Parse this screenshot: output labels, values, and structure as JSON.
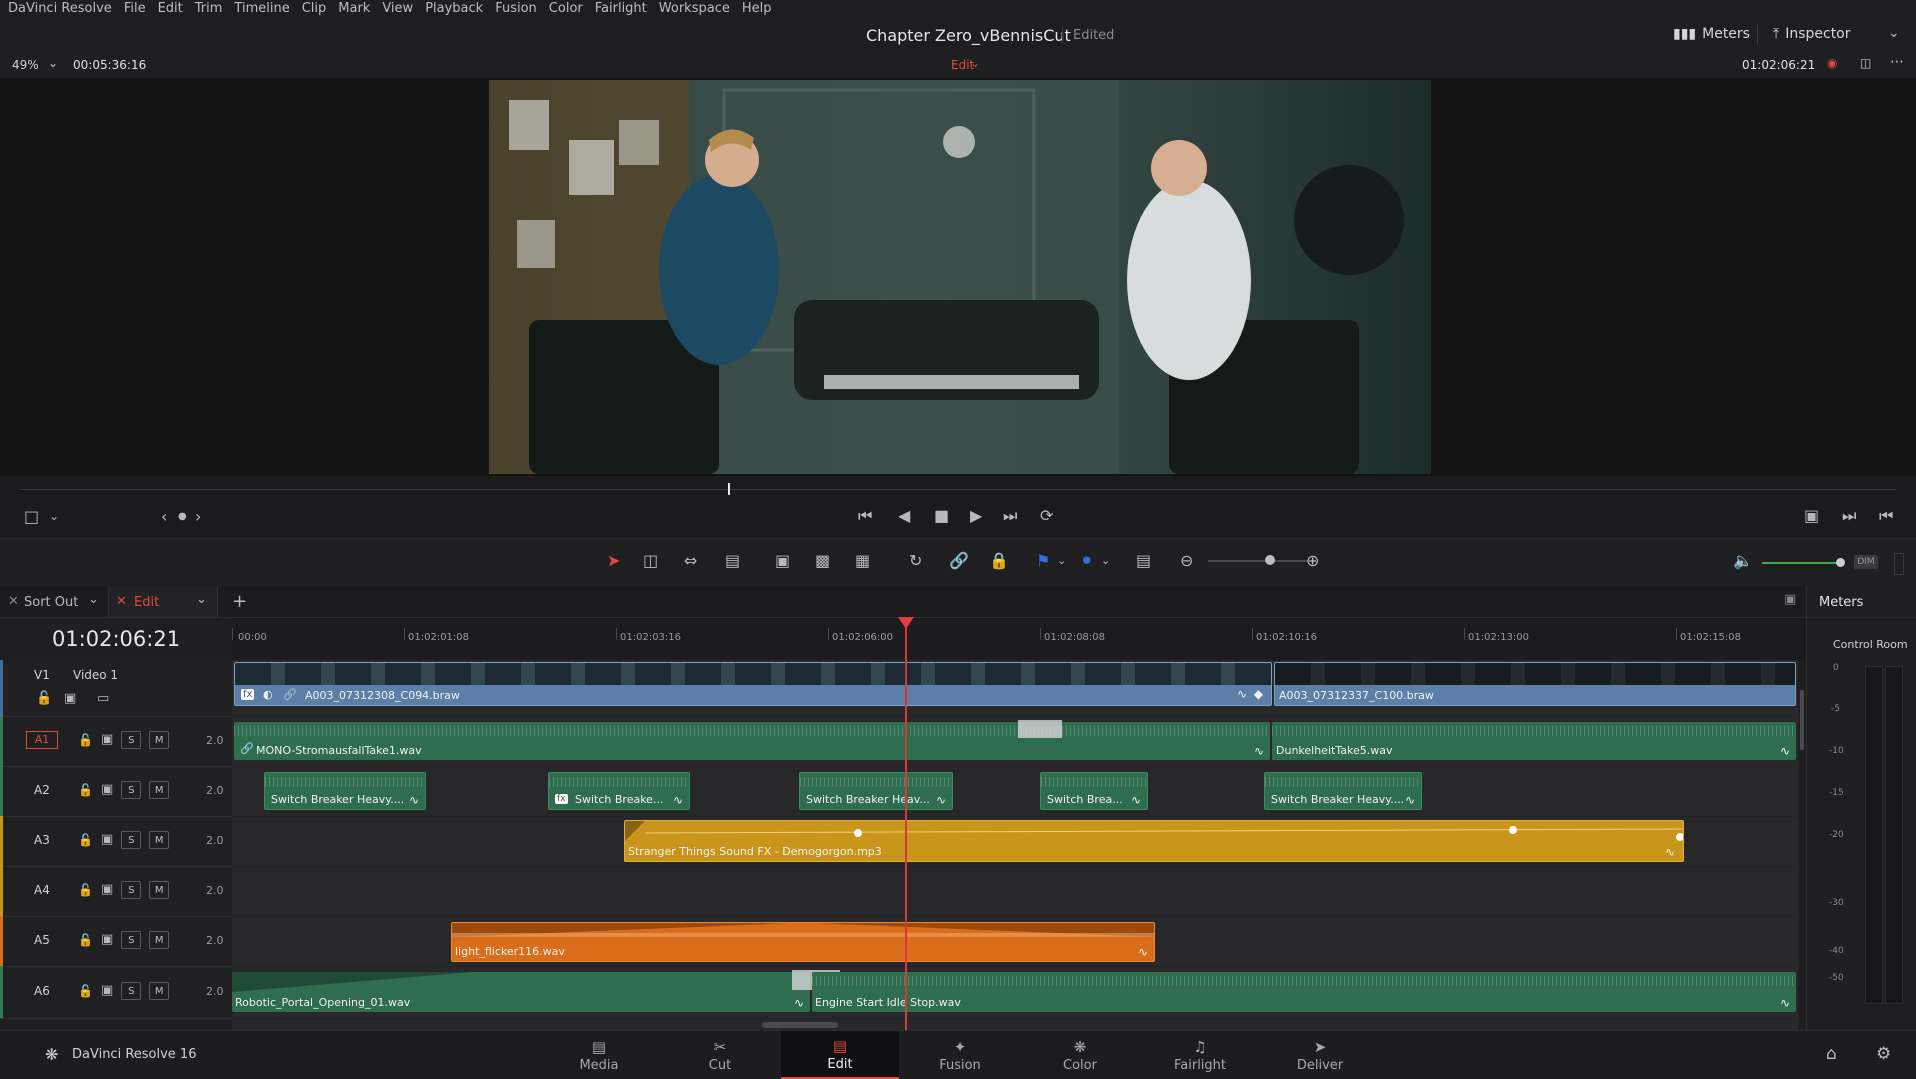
{
  "menu": [
    "DaVinci Resolve",
    "File",
    "Edit",
    "Trim",
    "Timeline",
    "Clip",
    "Mark",
    "View",
    "Playback",
    "Fusion",
    "Color",
    "Fairlight",
    "Workspace",
    "Help"
  ],
  "title": {
    "project": "Chapter Zero_vBennisCut",
    "status": "Edited"
  },
  "topbar": {
    "meters_label": "Meters",
    "inspector_label": "Inspector"
  },
  "viewer": {
    "zoom": "49%",
    "source_tc": "00:05:36:16",
    "mode_label": "Edit",
    "record_tc": "01:02:06:21"
  },
  "timeline_tabs": [
    {
      "label": "Sort Out"
    },
    {
      "label": "Edit"
    }
  ],
  "timeline": {
    "timecode": "01:02:06:21",
    "ruler": [
      "00:00",
      "01:02:01:08",
      "01:02:03:16",
      "01:02:06:00",
      "01:02:08:08",
      "01:02:10:16",
      "01:02:13:00",
      "01:02:15:08"
    ],
    "tracks": [
      {
        "id": "V1",
        "name": "Video 1"
      },
      {
        "id": "A1",
        "gain": "2.0"
      },
      {
        "id": "A2",
        "gain": "2.0"
      },
      {
        "id": "A3",
        "gain": "2.0"
      },
      {
        "id": "A4",
        "gain": "2.0"
      },
      {
        "id": "A5",
        "gain": "2.0"
      },
      {
        "id": "A6",
        "gain": "2.0"
      }
    ],
    "clips": {
      "v1_a": "A003_07312308_C094.braw",
      "v1_b": "A003_07312337_C100.braw",
      "a1_a": "MONO-StromausfallTake1.wav",
      "a1_b": "DunkelheitTake5.wav",
      "a2": [
        "Switch Breaker Heavy....",
        "Switch Breake...",
        "Switch Breaker Heav...",
        "Switch Brea...",
        "Switch Breaker Heavy...."
      ],
      "a3": "Stranger Things Sound FX - Demogorgon.mp3",
      "a5": "light_flicker116.wav",
      "a6_a": "Robotic_Portal_Opening_01.wav",
      "a6_b": "Engine Start Idle Stop.wav"
    },
    "track_buttons": {
      "solo": "S",
      "mute": "M"
    }
  },
  "meters": {
    "title": "Meters",
    "subtitle": "Control Room",
    "scale": [
      "0",
      "-5",
      "-10",
      "-15",
      "-20",
      "-30",
      "-40",
      "-50"
    ],
    "dim_label": "DIM"
  },
  "app": {
    "name": "DaVinci Resolve 16"
  },
  "pages": [
    "Media",
    "Cut",
    "Edit",
    "Fusion",
    "Color",
    "Fairlight",
    "Deliver"
  ],
  "colors": {
    "accent": "#e04b3a",
    "video_clip": "#5b7fa6",
    "audio_green": "#2f6d4f",
    "audio_yellow": "#c9951b",
    "audio_orange": "#d96d1a",
    "playhead": "#d23a3a"
  }
}
